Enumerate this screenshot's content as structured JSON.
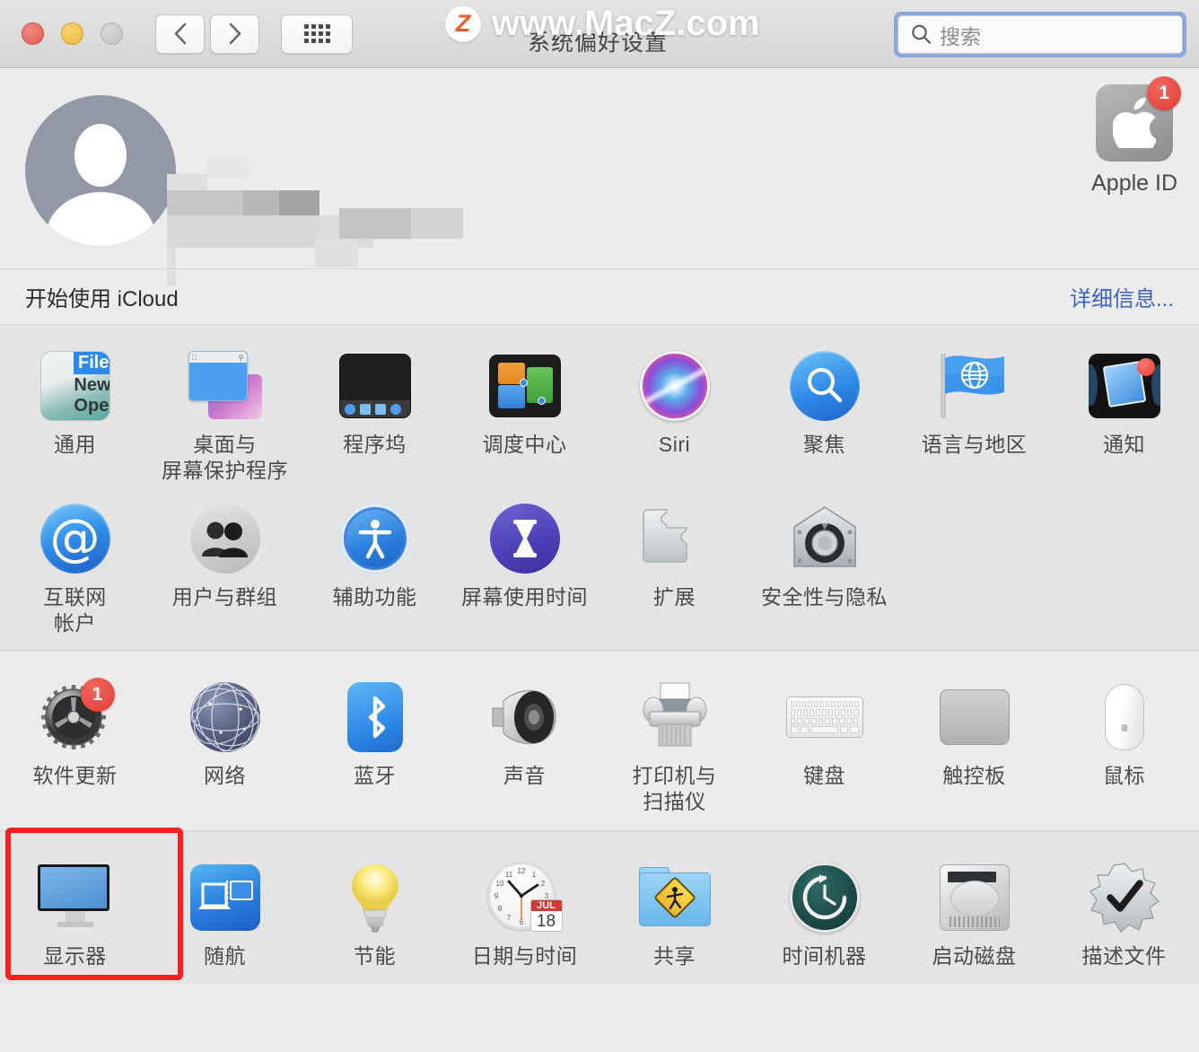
{
  "window": {
    "title": "系统偏好设置",
    "watermark_badge": "Z",
    "watermark_text": "www.MacZ.com"
  },
  "toolbar": {
    "back_label": "返回",
    "forward_label": "前进",
    "grid_label": "显示全部",
    "traffic": {
      "close": "关闭",
      "minimize": "最小化",
      "zoom": "缩放"
    }
  },
  "search": {
    "placeholder": "搜索",
    "value": "",
    "icon": "search-icon"
  },
  "account": {
    "avatar_icon": "user-avatar-icon",
    "name_redacted": "",
    "apple_id_label": "Apple ID",
    "apple_id_badge": "1",
    "icloud_label": "开始使用 iCloud",
    "details_label": "详细信息..."
  },
  "sections": [
    {
      "id": "personal",
      "items": [
        {
          "label": "通用",
          "icon": "general-icon",
          "badge": ""
        },
        {
          "label": "桌面与\n屏幕保护程序",
          "icon": "desktop-screensaver-icon",
          "badge": ""
        },
        {
          "label": "程序坞",
          "icon": "dock-icon",
          "badge": ""
        },
        {
          "label": "调度中心",
          "icon": "mission-control-icon",
          "badge": ""
        },
        {
          "label": "Siri",
          "icon": "siri-icon",
          "badge": ""
        },
        {
          "label": "聚焦",
          "icon": "spotlight-icon",
          "badge": ""
        },
        {
          "label": "语言与地区",
          "icon": "language-region-icon",
          "badge": ""
        },
        {
          "label": "通知",
          "icon": "notifications-icon",
          "badge": ""
        },
        {
          "label": "互联网\n帐户",
          "icon": "internet-accounts-icon",
          "badge": ""
        },
        {
          "label": "用户与群组",
          "icon": "users-groups-icon",
          "badge": ""
        },
        {
          "label": "辅助功能",
          "icon": "accessibility-icon",
          "badge": ""
        },
        {
          "label": "屏幕使用时间",
          "icon": "screen-time-icon",
          "badge": ""
        },
        {
          "label": "扩展",
          "icon": "extensions-icon",
          "badge": ""
        },
        {
          "label": "安全性与隐私",
          "icon": "security-privacy-icon",
          "badge": ""
        }
      ]
    },
    {
      "id": "hardware",
      "items": [
        {
          "label": "软件更新",
          "icon": "software-update-icon",
          "badge": "1"
        },
        {
          "label": "网络",
          "icon": "network-icon",
          "badge": ""
        },
        {
          "label": "蓝牙",
          "icon": "bluetooth-icon",
          "badge": ""
        },
        {
          "label": "声音",
          "icon": "sound-icon",
          "badge": ""
        },
        {
          "label": "打印机与\n扫描仪",
          "icon": "printers-scanners-icon",
          "badge": ""
        },
        {
          "label": "键盘",
          "icon": "keyboard-icon",
          "badge": ""
        },
        {
          "label": "触控板",
          "icon": "trackpad-icon",
          "badge": ""
        },
        {
          "label": "鼠标",
          "icon": "mouse-icon",
          "badge": ""
        }
      ]
    },
    {
      "id": "system",
      "items": [
        {
          "label": "显示器",
          "icon": "displays-icon",
          "badge": "",
          "highlighted": true
        },
        {
          "label": "随航",
          "icon": "sidecar-icon",
          "badge": ""
        },
        {
          "label": "节能",
          "icon": "energy-saver-icon",
          "badge": ""
        },
        {
          "label": "日期与时间",
          "icon": "date-time-icon",
          "badge": ""
        },
        {
          "label": "共享",
          "icon": "sharing-icon",
          "badge": ""
        },
        {
          "label": "时间机器",
          "icon": "time-machine-icon",
          "badge": ""
        },
        {
          "label": "启动磁盘",
          "icon": "startup-disk-icon",
          "badge": ""
        },
        {
          "label": "描述文件",
          "icon": "profiles-icon",
          "badge": ""
        }
      ]
    }
  ],
  "date_time_icon": {
    "month": "JUL",
    "day": "18"
  },
  "general_icon": {
    "line1": "File",
    "line2": "New",
    "line3": "Ope"
  },
  "colors": {
    "accent_blue": "#3b62c4",
    "badge_red": "#e03c32",
    "highlight_red": "#f3211f",
    "window_bg": "#ececec",
    "pane_bg": "#e4e4e4",
    "label_gray": "#4a4a4a"
  }
}
